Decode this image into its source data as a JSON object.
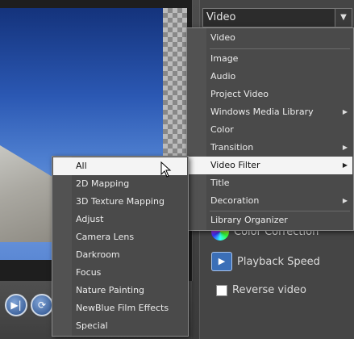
{
  "dropdown": {
    "value": "Video"
  },
  "main_menu": {
    "items": [
      {
        "label": "Video",
        "submenu": false
      },
      {
        "label": "Image",
        "submenu": false
      },
      {
        "label": "Audio",
        "submenu": false
      },
      {
        "label": "Project Video",
        "submenu": false
      },
      {
        "label": "Windows Media Library",
        "submenu": true
      },
      {
        "label": "Color",
        "submenu": false
      },
      {
        "label": "Transition",
        "submenu": true
      },
      {
        "label": "Video Filter",
        "submenu": true,
        "highlighted": true
      },
      {
        "label": "Title",
        "submenu": false
      },
      {
        "label": "Decoration",
        "submenu": true
      },
      {
        "label": "Library Organizer",
        "submenu": false
      }
    ]
  },
  "sub_menu": {
    "items": [
      {
        "label": "All",
        "highlighted": true
      },
      {
        "label": "2D Mapping"
      },
      {
        "label": "3D Texture Mapping"
      },
      {
        "label": "Adjust"
      },
      {
        "label": "Camera Lens"
      },
      {
        "label": "Darkroom"
      },
      {
        "label": "Focus"
      },
      {
        "label": "Nature Painting"
      },
      {
        "label": "NewBlue Film Effects"
      },
      {
        "label": "Special"
      }
    ]
  },
  "panel": {
    "color_correction": "Color Correction",
    "playback_speed": "Playback Speed",
    "reverse_video": "Reverse video"
  },
  "icons": {
    "play_step": "step-forward-icon",
    "repeat": "repeat-icon",
    "dropdown_arrow": "chevron-down-icon",
    "submenu_arrow": "triangle-right-icon"
  },
  "colors": {
    "menu_bg": "#4a4a4a",
    "highlight_bg": "#f4f4f4",
    "accent_blue": "#3b6fb7"
  }
}
